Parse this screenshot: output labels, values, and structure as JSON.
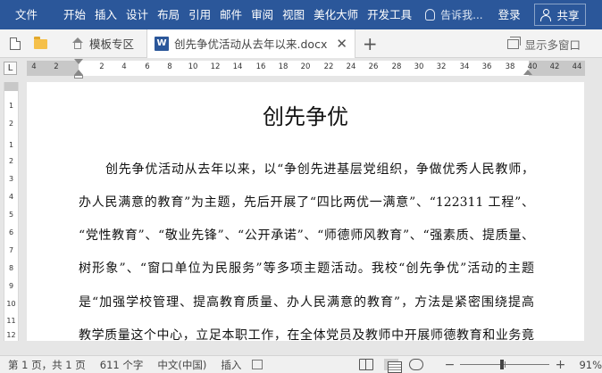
{
  "menu": {
    "items": [
      "文件",
      "开始",
      "插入",
      "设计",
      "布局",
      "引用",
      "邮件",
      "审阅",
      "视图",
      "美化大师",
      "开发工具"
    ],
    "tell_me": "告诉我...",
    "login": "登录",
    "share": "共享"
  },
  "tabs": {
    "home_label": "模板专区",
    "document_label": "创先争优活动从去年以来.docx",
    "close": "✕",
    "new_tab": "+",
    "multi_window": "显示多窗口"
  },
  "ruler": {
    "tab_selector": "L",
    "numbers": [
      "4",
      "2",
      "2",
      "4",
      "6",
      "8",
      "10",
      "12",
      "14",
      "16",
      "18",
      "20",
      "22",
      "24",
      "26",
      "28",
      "30",
      "32",
      "34",
      "36",
      "38",
      "40",
      "42",
      "44"
    ],
    "vertical_numbers": [
      "1",
      "2",
      "1",
      "2",
      "3",
      "4",
      "5",
      "6",
      "7",
      "8",
      "9",
      "10",
      "11",
      "12"
    ]
  },
  "document": {
    "title": "创先争优",
    "lines": [
      "创先争优活动从去年以来，以“争创先进基层党组织，争做优秀人民教师，",
      "办人民满意的教育”为主题，先后开展了“四比两优一满意”、“122311 工程”、",
      "“党性教育”、“敬业先锋”、“公开承诺”、“师德师风教育”、“强素质、提质量、",
      "树形象”、“窗口单位为民服务”等多项主题活动。我校“创先争优”活动的主题",
      "是“加强学校管理、提高教育质量、办人民满意的教育”，方法是紧密围绕提高",
      "教学质量这个中心，立足本职工作，在全体党员及教师中开展师德教育和业务竟"
    ]
  },
  "status": {
    "page": "第 1 页，共 1 页",
    "words": "611 个字",
    "language": "中文(中国)",
    "mode": "插入",
    "zoom_minus": "−",
    "zoom_plus": "+",
    "zoom": "91%",
    "zoom_value": 91
  },
  "colors": {
    "ribbon": "#2b579a",
    "word_logo": "#2b579a"
  }
}
